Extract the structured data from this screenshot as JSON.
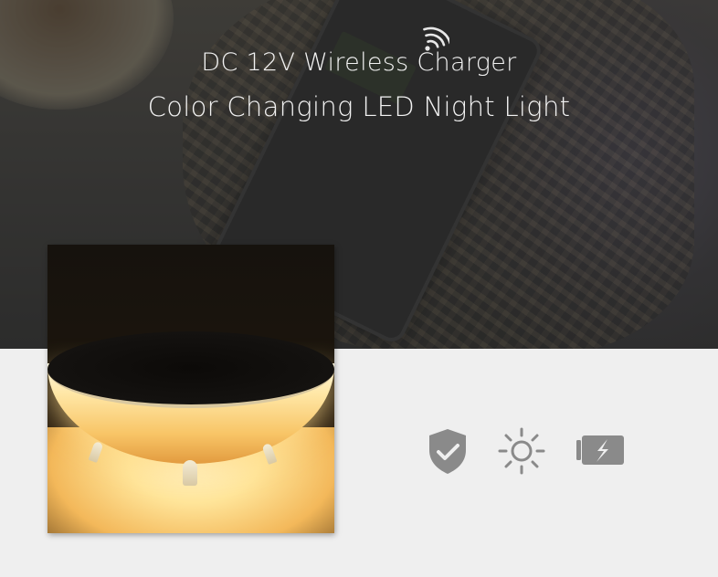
{
  "banner": {
    "title_line1": "DC 12V Wireless Charger",
    "title_line2": "Color Changing LED Night Light"
  },
  "icons": {
    "wifi": "wifi-signal-icon",
    "features": [
      {
        "icon": "shield-check-icon"
      },
      {
        "icon": "sun-brightness-icon"
      },
      {
        "icon": "battery-charging-icon"
      }
    ]
  },
  "colors": {
    "icon_gray": "#8a8a8a",
    "page_background": "#efefef",
    "title_text": "#f2f2f2",
    "light_glow": "#ffe59a"
  }
}
